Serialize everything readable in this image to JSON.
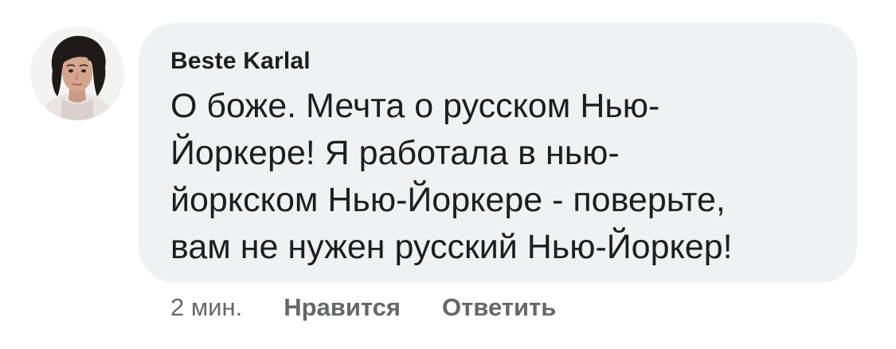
{
  "comment": {
    "author": "Beste Karlal",
    "text": "О боже.  Мечта о русском Нью-\nЙоркере!  Я работала в нью-\nйоркском Нью-Йоркере - поверьте,\nвам не нужен русский Нью-Йоркер!",
    "time": "2 мин.",
    "like_label": "Нравится",
    "reply_label": "Ответить"
  },
  "colors": {
    "bubble": "#f0f1f4",
    "text": "#1c1e21",
    "meta": "#65676b"
  },
  "icons": {
    "avatar": "user-avatar"
  }
}
